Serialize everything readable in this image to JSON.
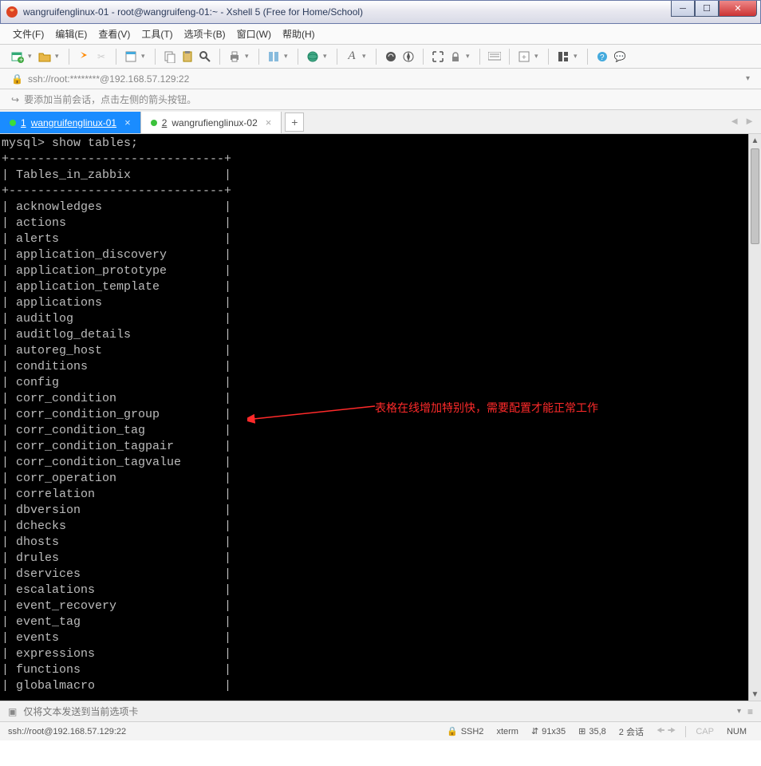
{
  "window": {
    "title": "wangruifenglinux-01 - root@wangruifeng-01:~ - Xshell 5 (Free for Home/School)"
  },
  "menu": {
    "items": [
      "文件(F)",
      "编辑(E)",
      "查看(V)",
      "工具(T)",
      "选项卡(B)",
      "窗口(W)",
      "帮助(H)"
    ]
  },
  "address": {
    "text": "ssh://root:********@192.168.57.129:22"
  },
  "hint": {
    "text": "要添加当前会话，点击左侧的箭头按钮。"
  },
  "tabs": {
    "items": [
      {
        "num": "1",
        "label": "wangruifenglinux-01",
        "active": true
      },
      {
        "num": "2",
        "label": "wangrufienglinux-02",
        "active": false
      }
    ]
  },
  "terminal": {
    "prompt": "mysql> show tables;",
    "header": "Tables_in_zabbix",
    "border": "+------------------------------+",
    "rows": [
      "acknowledges",
      "actions",
      "alerts",
      "application_discovery",
      "application_prototype",
      "application_template",
      "applications",
      "auditlog",
      "auditlog_details",
      "autoreg_host",
      "conditions",
      "config",
      "corr_condition",
      "corr_condition_group",
      "corr_condition_tag",
      "corr_condition_tagpair",
      "corr_condition_tagvalue",
      "corr_operation",
      "correlation",
      "dbversion",
      "dchecks",
      "dhosts",
      "drules",
      "dservices",
      "escalations",
      "event_recovery",
      "event_tag",
      "events",
      "expressions",
      "functions",
      "globalmacro"
    ]
  },
  "annotation": {
    "text": "表格在线增加特别快，需要配置才能正常工作",
    "color": "#ff2a2a"
  },
  "inputbar": {
    "placeholder": "仅将文本发送到当前选项卡"
  },
  "status": {
    "addr": "ssh://root@192.168.57.129:22",
    "proto": "SSH2",
    "term": "xterm",
    "size": "91x35",
    "pos": "35,8",
    "sessions": "2 会话",
    "caps": "CAP",
    "num": "NUM"
  }
}
